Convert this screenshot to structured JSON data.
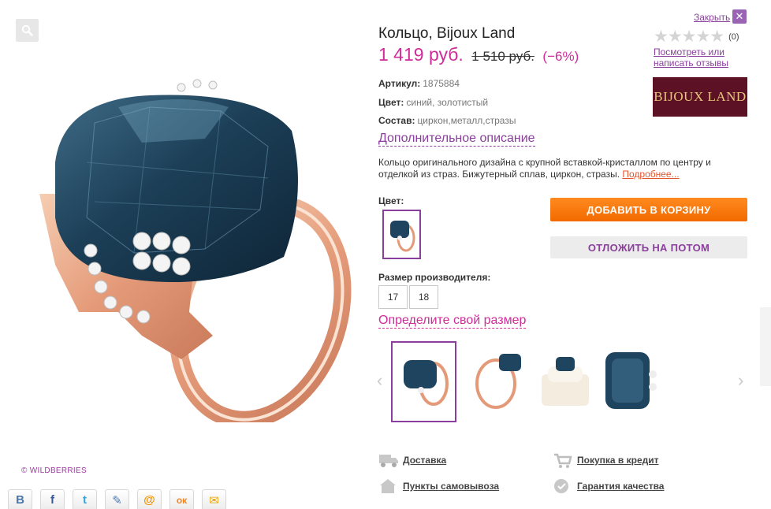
{
  "close": {
    "label": "Закрыть",
    "icon": "close-icon"
  },
  "product": {
    "title": "Кольцо, Bijoux Land",
    "price_now": "1 419 руб.",
    "price_old": "1 510 руб.",
    "discount": "(−6%)",
    "rating_count": "(0)",
    "review_link": "Посмотреть или написать отзывы",
    "brand_logo": "BIJOUX LAND"
  },
  "specs": {
    "article_label": "Артикул:",
    "article_value": "1875884",
    "color_label": "Цвет:",
    "color_value": "синий, золотистый",
    "material_label": "Состав:",
    "material_value": "циркон,металл,стразы"
  },
  "more_description": "Дополнительное описание",
  "description": {
    "text": "Кольцо оригинального дизайна с крупной вставкой-кристаллом по центру и отделкой из страз. Бижутерный сплав, циркон, стразы.",
    "more_link": "Подробнее..."
  },
  "color_section": {
    "label": "Цвет:"
  },
  "size_section": {
    "label": "Размер производителя:",
    "sizes": [
      "17",
      "18"
    ],
    "find_size_link": "Определите свой размер"
  },
  "actions": {
    "add_to_cart": "ДОБАВИТЬ В КОРЗИНУ",
    "save_for_later": "ОТЛОЖИТЬ НА ПОТОМ"
  },
  "info_links": {
    "delivery": "Доставка",
    "credit": "Покупка в кредит",
    "pickup": "Пункты самовывоза",
    "quality": "Гарантия качества"
  },
  "watermark": "© WILDBERRIES",
  "share": {
    "vk": "B",
    "facebook": "f",
    "twitter": "t",
    "livejournal": "✎",
    "mailru": "@",
    "odnoklassniki": "ок",
    "email": "✉"
  },
  "colors": {
    "accent_purple": "#8a3f9c",
    "price_pink": "#cf2c9a",
    "cart_orange": "#f26a00",
    "brand_bg": "#5c1224"
  }
}
